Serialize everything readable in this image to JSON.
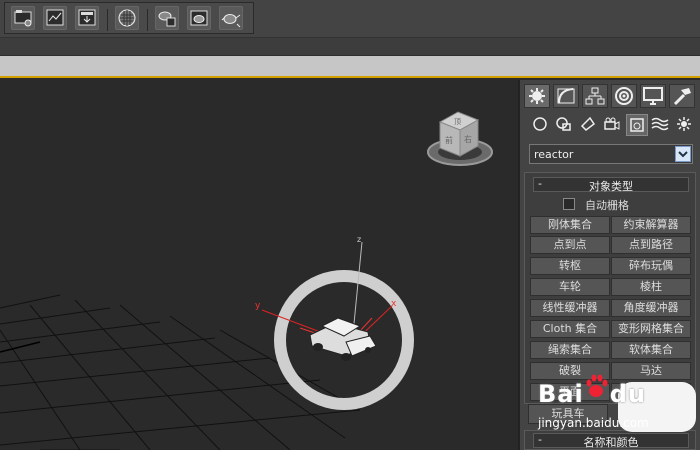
{
  "toolbar": {
    "buttons": [
      {
        "icon": "render-setup-icon"
      },
      {
        "icon": "rendered-frame-window-icon"
      },
      {
        "icon": "render-production-icon"
      },
      {
        "icon": "material-editor-icon"
      },
      {
        "icon": "render-iterative-icon"
      },
      {
        "icon": "active-shade-icon"
      },
      {
        "icon": "render-teapot-icon"
      }
    ]
  },
  "command_panel": {
    "tabs": [
      "create-tab",
      "modify-tab",
      "hierarchy-tab",
      "motion-tab",
      "display-tab",
      "utilities-tab"
    ],
    "subtabs": [
      "geometry",
      "shapes",
      "lights",
      "cameras",
      "helpers",
      "space-warps",
      "systems"
    ],
    "category_value": "reactor",
    "object_type": {
      "title": "对象类型",
      "collapse_symbol": "-",
      "autogrid_label": "自动栅格",
      "autogrid_checked": false,
      "buttons": [
        [
          "刚体集合",
          "约束解算器"
        ],
        [
          "点到点",
          "点到路径"
        ],
        [
          "转枢",
          "碎布玩偶"
        ],
        [
          "车轮",
          "棱柱"
        ],
        [
          "线性缓冲器",
          "角度缓冲器"
        ],
        [
          "Cloth 集合",
          "变形网格集合"
        ],
        [
          "绳索集合",
          "软体集合"
        ],
        [
          "破裂",
          "马达"
        ],
        [
          "平面",
          ""
        ]
      ],
      "extra_button": "玩具车"
    },
    "name_color": {
      "title": "名称和颜色",
      "collapse_symbol": "-"
    }
  },
  "viewport": {
    "axis_labels": {
      "x": "x",
      "y": "y",
      "z": "z"
    },
    "viewcube_faces": {
      "front": "前",
      "top": "顶",
      "right": "右"
    }
  },
  "watermark": {
    "logo": "Bai",
    "logo_tail": "du",
    "site": "jingyan.baidu.com"
  }
}
